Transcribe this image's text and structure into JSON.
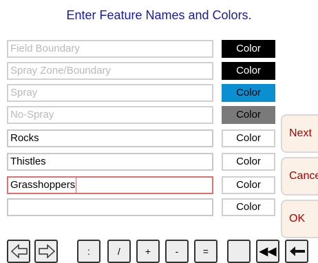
{
  "title": "Enter Feature Names and Colors.",
  "features": [
    {
      "name": "Field Boundary",
      "color_label": "Color",
      "color_bg": "#000000",
      "color_fg": "#ffffff",
      "state": "dim"
    },
    {
      "name": "Spray Zone/Boundary",
      "color_label": "Color",
      "color_bg": "#000000",
      "color_fg": "#ffffff",
      "state": "dim"
    },
    {
      "name": "Spray",
      "color_label": "Color",
      "color_bg": "#0a8fd0",
      "color_fg": "#000000",
      "state": "dim"
    },
    {
      "name": "No-Spray",
      "color_label": "Color",
      "color_bg": "#7a7a7a",
      "color_fg": "#000000",
      "state": "dim"
    },
    {
      "name": "Rocks",
      "color_label": "Color",
      "color_bg": "#ffffff",
      "color_fg": "#000000",
      "state": "active"
    },
    {
      "name": "Thistles",
      "color_label": "Color",
      "color_bg": "#ffffff",
      "color_fg": "#000000",
      "state": "active"
    },
    {
      "name": "Grasshoppers",
      "color_label": "Color",
      "color_bg": "#ffffff",
      "color_fg": "#000000",
      "state": "focus"
    },
    {
      "name": "",
      "color_label": "Color",
      "color_bg": "#ffffff",
      "color_fg": "#000000",
      "state": "active"
    }
  ],
  "side_buttons": {
    "next": "Next",
    "cancel": "Cancel",
    "ok": "OK"
  },
  "keyboard": {
    "keys": [
      {
        "name": "left-arrow-icon",
        "label": ""
      },
      {
        "name": "right-arrow-icon",
        "label": ""
      },
      {
        "name": "key-colon",
        "label": ":"
      },
      {
        "name": "key-slash",
        "label": "/"
      },
      {
        "name": "key-plus",
        "label": "+"
      },
      {
        "name": "key-minus",
        "label": "-"
      },
      {
        "name": "key-equals",
        "label": "="
      },
      {
        "name": "key-blank",
        "label": ""
      },
      {
        "name": "key-double-back",
        "label": "◀◀"
      },
      {
        "name": "backspace-icon",
        "label": ""
      }
    ]
  },
  "colors": {
    "title": "#1a1aa0",
    "side_text": "#b00000",
    "side_bg": "#fcf1e6",
    "focus_border": "#e07070"
  }
}
